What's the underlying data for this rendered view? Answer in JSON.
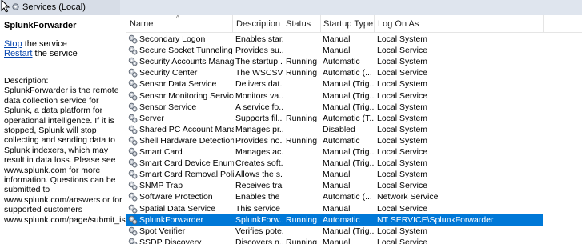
{
  "header": {
    "title": "Services (Local)"
  },
  "left_panel": {
    "service_name": "SplunkForwarder",
    "stop_link": "Stop",
    "stop_suffix": " the service",
    "restart_link": "Restart",
    "restart_suffix": " the service",
    "desc_label": "Description:",
    "description": "SplunkForwarder is the remote data collection service for Splunk, a data platform for operational intelligence. If it is stopped, Splunk will stop collecting and sending data to Splunk indexers, which may result in data loss. Please see www.splunk.com for more information. Questions can be submitted to www.splunk.com/answers or for supported customers www.splunk.com/page/submit_issue"
  },
  "columns": [
    "Name",
    "Description",
    "Status",
    "Startup Type",
    "Log On As"
  ],
  "rows": [
    {
      "name": "Secondary Logon",
      "desc": "Enables star...",
      "status": "",
      "startup": "Manual",
      "logon": "Local System",
      "icon": "service-gear-icon"
    },
    {
      "name": "Secure Socket Tunneling Pr...",
      "desc": "Provides su...",
      "status": "",
      "startup": "Manual",
      "logon": "Local Service",
      "icon": "service-gear-icon"
    },
    {
      "name": "Security Accounts Manager",
      "desc": "The startup ...",
      "status": "Running",
      "startup": "Automatic",
      "logon": "Local System",
      "icon": "service-gear-icon"
    },
    {
      "name": "Security Center",
      "desc": "The WSCSV...",
      "status": "Running",
      "startup": "Automatic (...",
      "logon": "Local Service",
      "icon": "service-gear-icon"
    },
    {
      "name": "Sensor Data Service",
      "desc": "Delivers dat...",
      "status": "",
      "startup": "Manual (Trig...",
      "logon": "Local System",
      "icon": "service-gear-icon"
    },
    {
      "name": "Sensor Monitoring Service",
      "desc": "Monitors va...",
      "status": "",
      "startup": "Manual (Trig...",
      "logon": "Local Service",
      "icon": "service-gear-icon"
    },
    {
      "name": "Sensor Service",
      "desc": "A service fo...",
      "status": "",
      "startup": "Manual (Trig...",
      "logon": "Local System",
      "icon": "service-gear-icon"
    },
    {
      "name": "Server",
      "desc": "Supports fil...",
      "status": "Running",
      "startup": "Automatic (T...",
      "logon": "Local System",
      "icon": "service-gear-icon"
    },
    {
      "name": "Shared PC Account Manager",
      "desc": "Manages pr...",
      "status": "",
      "startup": "Disabled",
      "logon": "Local System",
      "icon": "service-gear-icon"
    },
    {
      "name": "Shell Hardware Detection",
      "desc": "Provides no...",
      "status": "Running",
      "startup": "Automatic",
      "logon": "Local System",
      "icon": "service-gear-icon"
    },
    {
      "name": "Smart Card",
      "desc": "Manages ac...",
      "status": "",
      "startup": "Manual (Trig...",
      "logon": "Local Service",
      "icon": "service-gear-icon"
    },
    {
      "name": "Smart Card Device Enumera...",
      "desc": "Creates soft...",
      "status": "",
      "startup": "Manual (Trig...",
      "logon": "Local System",
      "icon": "service-gear-icon"
    },
    {
      "name": "Smart Card Removal Policy",
      "desc": "Allows the s...",
      "status": "",
      "startup": "Manual",
      "logon": "Local System",
      "icon": "service-gear-icon"
    },
    {
      "name": "SNMP Trap",
      "desc": "Receives tra...",
      "status": "",
      "startup": "Manual",
      "logon": "Local Service",
      "icon": "service-gear-icon"
    },
    {
      "name": "Software Protection",
      "desc": "Enables the ...",
      "status": "",
      "startup": "Automatic (...",
      "logon": "Network Service",
      "icon": "service-gear-icon"
    },
    {
      "name": "Spatial Data Service",
      "desc": "This service ...",
      "status": "",
      "startup": "Manual",
      "logon": "Local Service",
      "icon": "service-gear-icon"
    },
    {
      "name": "SplunkForwarder",
      "desc": "SplunkForw...",
      "status": "Running",
      "startup": "Automatic",
      "logon": "NT SERVICE\\SplunkForwarder",
      "icon": "service-gear-icon",
      "selected": true
    },
    {
      "name": "Spot Verifier",
      "desc": "Verifies pote...",
      "status": "",
      "startup": "Manual (Trig...",
      "logon": "Local System",
      "icon": "service-gear-icon"
    },
    {
      "name": "SSDP Discovery",
      "desc": "Discovers n...",
      "status": "Running",
      "startup": "Manual",
      "logon": "Local Service",
      "icon": "service-gear-icon"
    }
  ],
  "colors": {
    "selection": "#0078d7",
    "link": "#0645ad",
    "header_band": "#d7dde7"
  }
}
